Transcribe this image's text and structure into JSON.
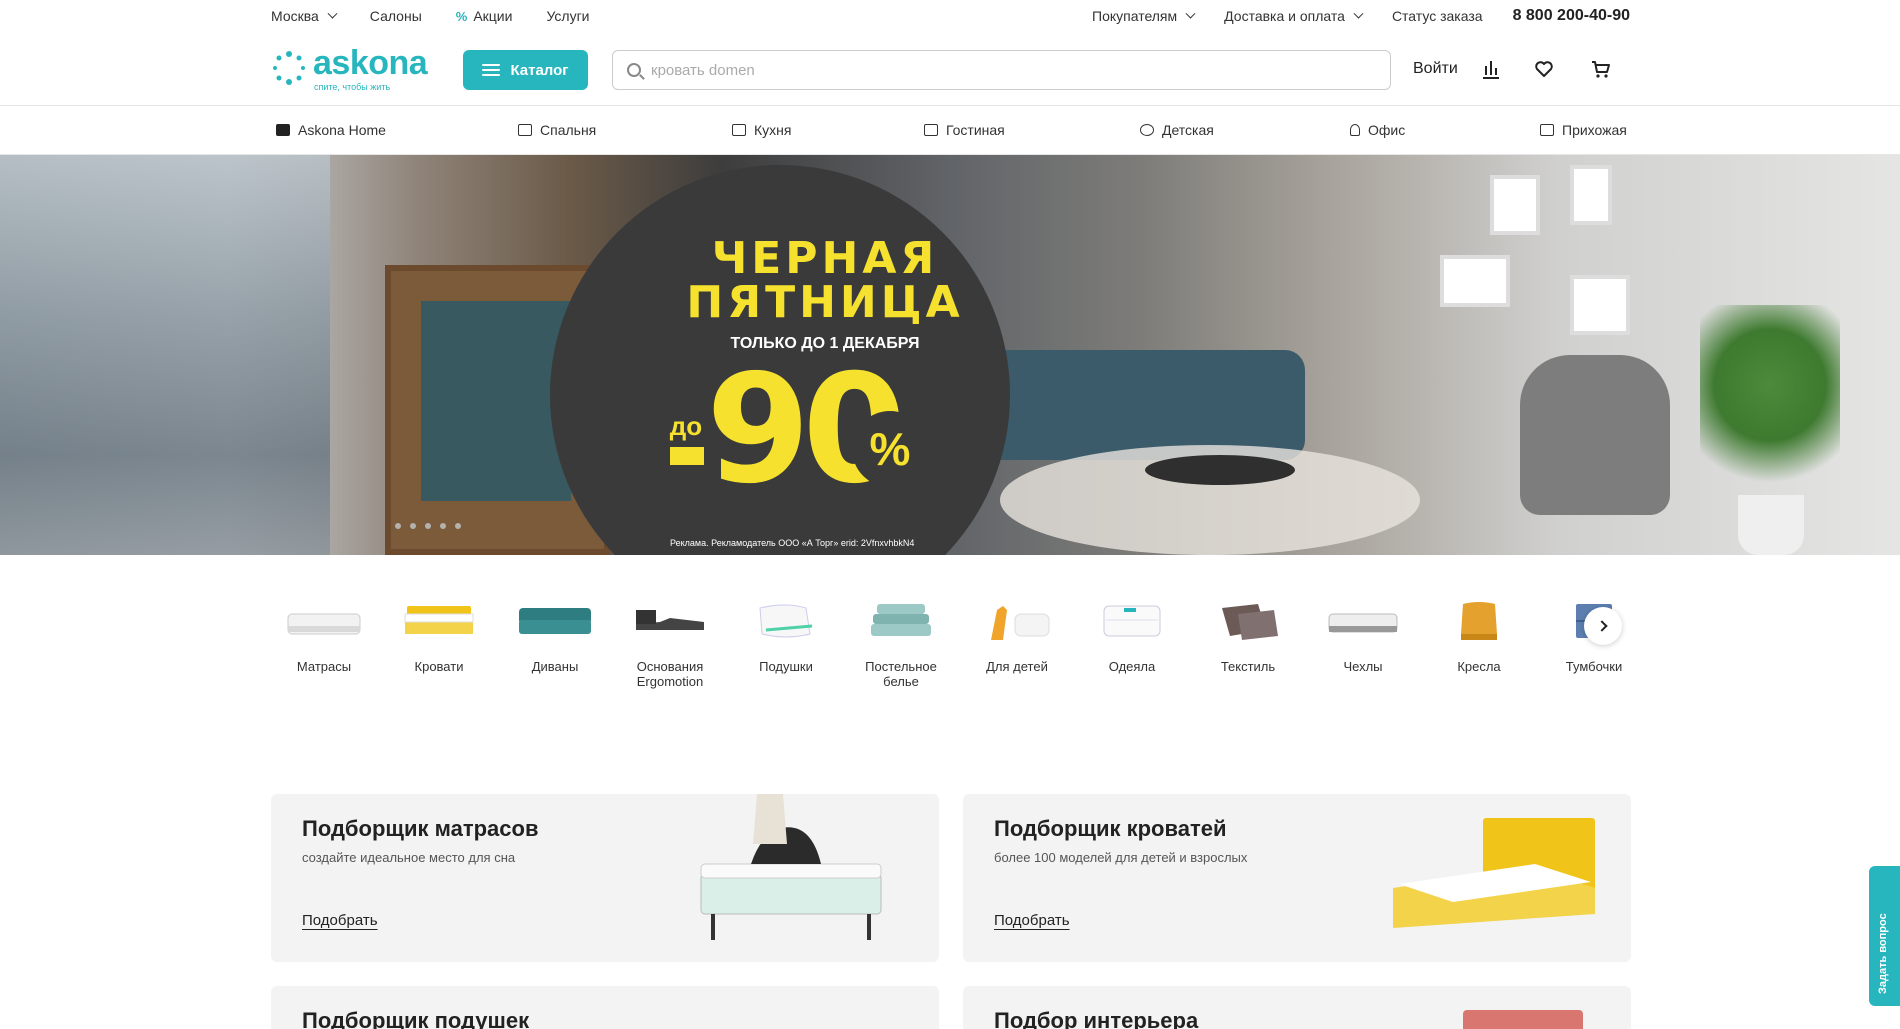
{
  "topbar": {
    "city": "Москва",
    "salons": "Салоны",
    "promo_icon": "%",
    "promos": "Акции",
    "services": "Услуги",
    "buyers": "Покупателям",
    "delivery": "Доставка и оплата",
    "order_status": "Статус заказа",
    "phone": "8 800 200-40-90"
  },
  "header": {
    "logo_word": "askona",
    "logo_tagline": "спите, чтобы жить",
    "catalog_label": "Каталог",
    "search_placeholder": "кровать domen",
    "login_label": "Войти",
    "icons": [
      "compare-icon",
      "heart-icon",
      "cart-icon"
    ]
  },
  "room_nav": [
    {
      "label": "Askona Home",
      "icon": "home-brand-icon"
    },
    {
      "label": "Спальня",
      "icon": "bed-icon"
    },
    {
      "label": "Кухня",
      "icon": "kitchen-icon"
    },
    {
      "label": "Гостиная",
      "icon": "sofa-icon"
    },
    {
      "label": "Детская",
      "icon": "rocking-horse-icon"
    },
    {
      "label": "Офис",
      "icon": "office-chair-icon"
    },
    {
      "label": "Прихожая",
      "icon": "hallway-icon"
    }
  ],
  "hero": {
    "title_line1": "ЧЕРНАЯ",
    "title_line2": "ПЯТНИЦА",
    "subtitle": "ТОЛЬКО ДО 1 ДЕКАБРЯ",
    "discount_prefix": "до",
    "discount_value": "90",
    "discount_sign": "%",
    "ad_note": "Реклама. Рекламодатель ООО «А Торг» erid: 2VfnxvhbkN4",
    "slide_count": 5,
    "accent_color": "#f5e12e"
  },
  "categories": [
    {
      "label": "Матрасы"
    },
    {
      "label": "Кровати"
    },
    {
      "label": "Диваны"
    },
    {
      "label": "Основания Ergomotion"
    },
    {
      "label": "Подушки"
    },
    {
      "label": "Постельное белье"
    },
    {
      "label": "Для детей"
    },
    {
      "label": "Одеяла"
    },
    {
      "label": "Текстиль"
    },
    {
      "label": "Чехлы"
    },
    {
      "label": "Кресла"
    },
    {
      "label": "Тумбочки"
    }
  ],
  "pickers": [
    {
      "title": "Подборщик матрасов",
      "subtitle": "создайте идеальное место для сна",
      "action": "Подобрать"
    },
    {
      "title": "Подборщик кроватей",
      "subtitle": "более 100 моделей для детей и взрослых",
      "action": "Подобрать"
    },
    {
      "title": "Подборщик подушек"
    },
    {
      "title": "Подбор интерьера"
    }
  ],
  "ask_tab": "Задать вопрос",
  "colors": {
    "brand": "#27b6bd",
    "card_bg": "#f3f3f3"
  }
}
